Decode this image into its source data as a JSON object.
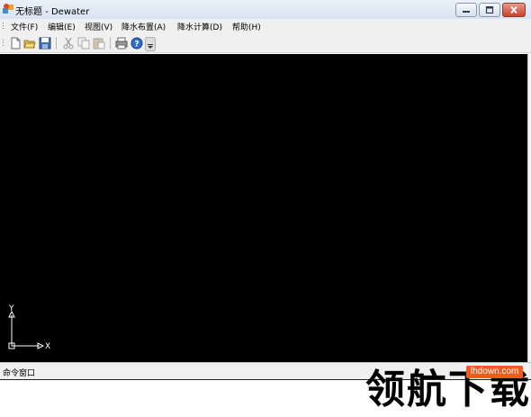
{
  "window": {
    "title": "无标题 - Dewater"
  },
  "menubar": {
    "items": [
      {
        "label": "文件(F)"
      },
      {
        "label": "编辑(E)"
      },
      {
        "label": "视图(V)"
      },
      {
        "label": "降水布置(A)"
      },
      {
        "label": "降水计算(D)"
      },
      {
        "label": "帮助(H)"
      }
    ]
  },
  "toolbar": {
    "icons": [
      "new-file-icon",
      "open-folder-icon",
      "save-icon",
      "cut-icon",
      "copy-icon",
      "paste-icon",
      "print-icon",
      "help-icon"
    ]
  },
  "canvas": {
    "background": "#000000",
    "ucs": {
      "x_label": "X",
      "y_label": "Y"
    }
  },
  "command_window": {
    "title": "命令窗口"
  },
  "watermark": {
    "text": "领航下载",
    "badge": "lhdown.com"
  }
}
